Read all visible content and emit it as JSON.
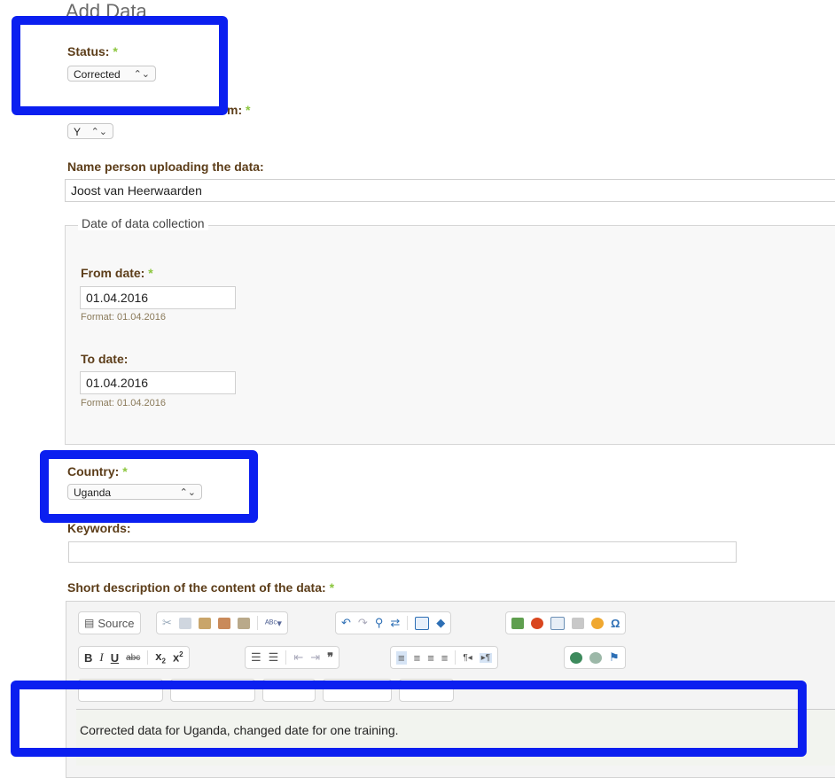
{
  "page": {
    "heading": "Add Data"
  },
  "status": {
    "label": "Status:",
    "required": "*",
    "value": "Corrected"
  },
  "second_field": {
    "label_fragment": "m:",
    "required": "*",
    "value": "Y"
  },
  "uploader": {
    "label": "Name person uploading the data:",
    "value": "Joost van Heerwaarden"
  },
  "date_collection": {
    "legend": "Date of data collection",
    "from": {
      "label": "From date:",
      "required": "*",
      "value": "01.04.2016",
      "hint": "Format: 01.04.2016"
    },
    "to": {
      "label": "To date:",
      "value": "01.04.2016",
      "hint": "Format: 01.04.2016"
    }
  },
  "country": {
    "label": "Country:",
    "required": "*",
    "value": "Uganda"
  },
  "keywords": {
    "label": "Keywords:",
    "value": ""
  },
  "description": {
    "label": "Short description of the content of the data:",
    "required": "*",
    "source_label": "Source",
    "content": "Corrected data for Uganda, changed date for one training."
  },
  "colors": {
    "label": "#5c3d19",
    "required": "#8cc63f",
    "highlight": "#0b1ff0",
    "hint": "#8a7a5a"
  }
}
